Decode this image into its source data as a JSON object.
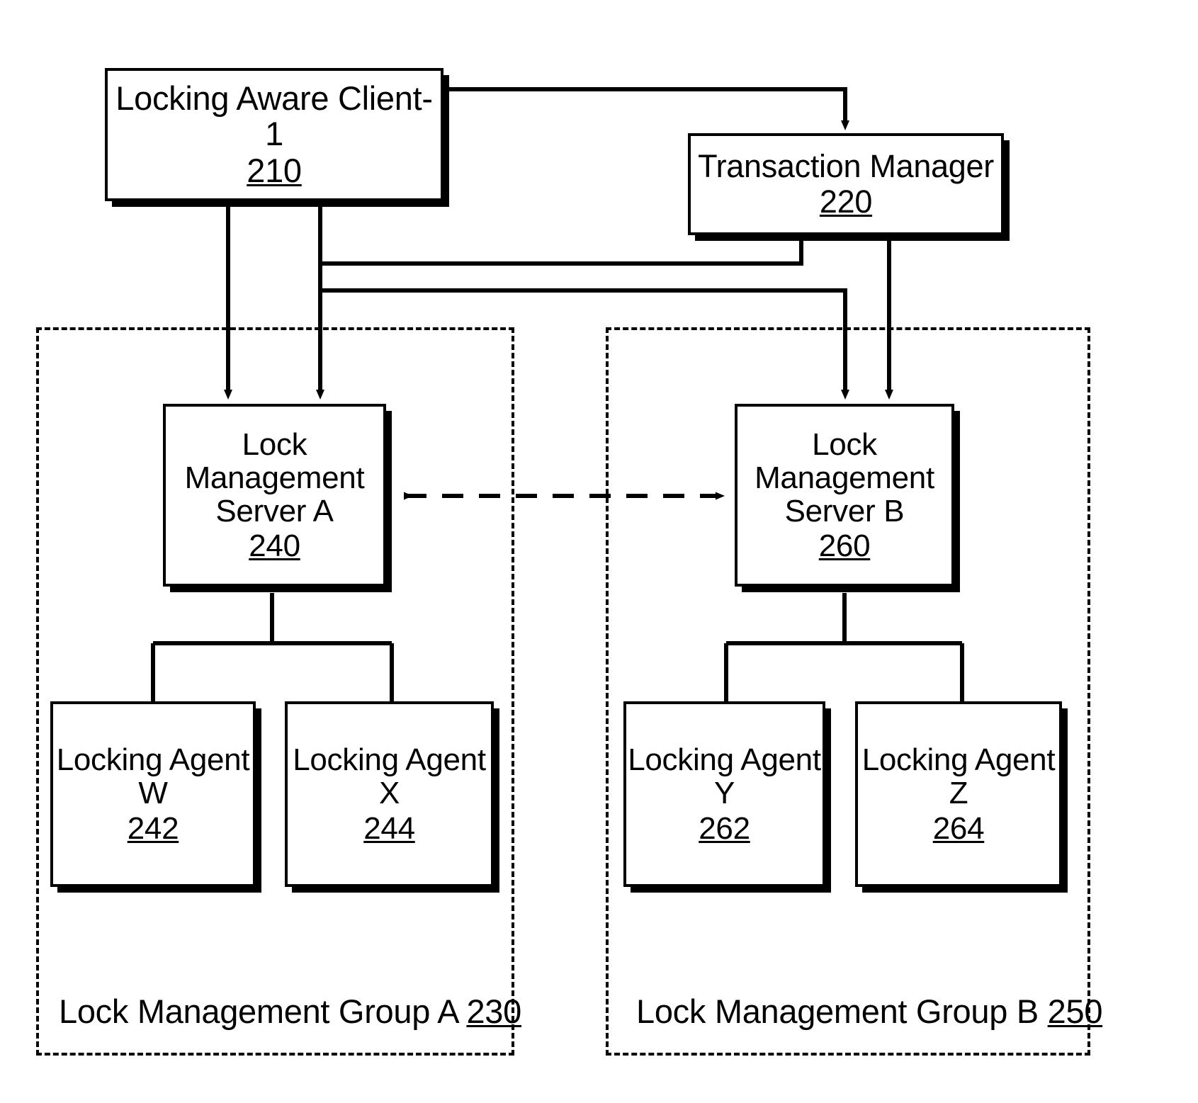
{
  "figure": {
    "title": "Lock Management System Diagram",
    "line_color": "#000000",
    "background": "#ffffff"
  },
  "nodes": {
    "client1": {
      "label": "Locking Aware Client-1",
      "ref": "210"
    },
    "txmgr": {
      "label": "Transaction Manager",
      "ref": "220"
    },
    "serverA": {
      "label": "Lock\nManagement\nServer A",
      "ref": "240"
    },
    "serverB": {
      "label": "Lock\nManagement\nServer B",
      "ref": "260"
    },
    "agentW": {
      "label": "Locking Agent\nW",
      "ref": "242"
    },
    "agentX": {
      "label": "Locking Agent\nX",
      "ref": "244"
    },
    "agentY": {
      "label": "Locking Agent\nY",
      "ref": "262"
    },
    "agentZ": {
      "label": "Locking Agent\nZ",
      "ref": "264"
    }
  },
  "groups": {
    "groupA": {
      "label": "Lock Management Group A",
      "ref": "230"
    },
    "groupB": {
      "label": "Lock Management Group B",
      "ref": "250"
    }
  },
  "connections": [
    {
      "name": "client1-to-transaction-manager",
      "style": "solid-arrow",
      "from": "client1",
      "to": "txmgr"
    },
    {
      "name": "client1-to-server-a",
      "style": "solid-arrow",
      "from": "client1",
      "to": "serverA"
    },
    {
      "name": "client1-to-server-b",
      "style": "solid-arrow",
      "from": "client1",
      "to": "serverB"
    },
    {
      "name": "transaction-manager-to-server-a",
      "style": "solid-arrow",
      "from": "txmgr",
      "to": "serverA"
    },
    {
      "name": "transaction-manager-to-server-b",
      "style": "solid-arrow",
      "from": "txmgr",
      "to": "serverB"
    },
    {
      "name": "server-a-to-server-b-sync",
      "style": "dashed-double-arrow",
      "from": "serverA",
      "to": "serverB"
    },
    {
      "name": "server-a-to-agent-w",
      "style": "solid-line",
      "from": "serverA",
      "to": "agentW"
    },
    {
      "name": "server-a-to-agent-x",
      "style": "solid-line",
      "from": "serverA",
      "to": "agentX"
    },
    {
      "name": "server-b-to-agent-y",
      "style": "solid-line",
      "from": "serverB",
      "to": "agentY"
    },
    {
      "name": "server-b-to-agent-z",
      "style": "solid-line",
      "from": "serverB",
      "to": "agentZ"
    }
  ]
}
